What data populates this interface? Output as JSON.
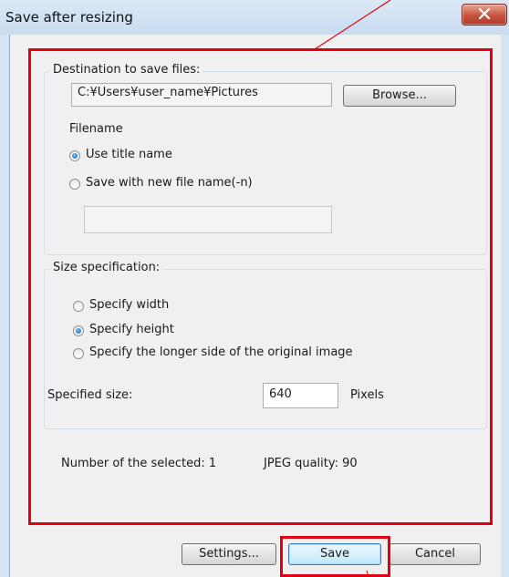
{
  "window": {
    "title": "Save after resizing"
  },
  "destination": {
    "group_label": "Destination to save files:",
    "path": "C:¥Users¥user_name¥Pictures",
    "browse_label": "Browse..."
  },
  "filename": {
    "label": "Filename",
    "options": [
      {
        "label": "Use title name",
        "selected": true
      },
      {
        "label": "Save with new file name(-n)",
        "selected": false
      }
    ],
    "new_name_value": ""
  },
  "size": {
    "group_label": "Size specification:",
    "options": [
      {
        "label": "Specify width",
        "selected": false
      },
      {
        "label": "Specify height",
        "selected": true
      },
      {
        "label": "Specify the longer side of the original image",
        "selected": false
      }
    ],
    "specified_label": "Specified size:",
    "specified_value": "640",
    "unit": "Pixels"
  },
  "status": {
    "selected_count": "Number of the selected: 1",
    "jpeg_quality": "JPEG quality: 90"
  },
  "buttons": {
    "settings": "Settings...",
    "save": "Save",
    "cancel": "Cancel"
  },
  "colors": {
    "highlight": "#e00012",
    "annotation_line": "#e00012"
  },
  "icons": {
    "close": "close-x-icon"
  }
}
